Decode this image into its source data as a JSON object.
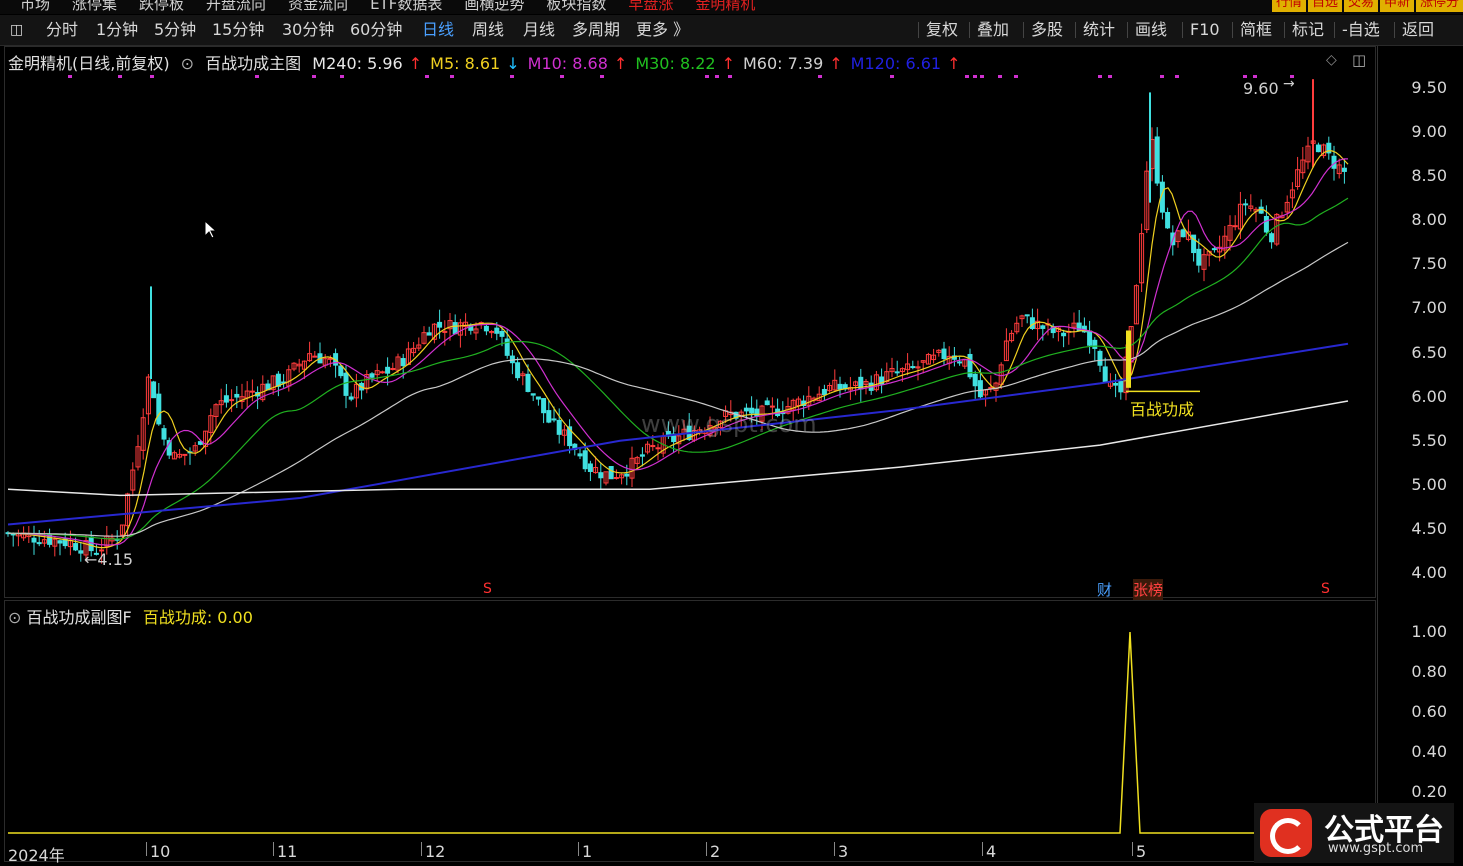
{
  "top_menu": {
    "items": [
      "市场",
      "涨停集",
      "跌停板",
      "开盘流向",
      "资金流向",
      "ETF数据表",
      "画横逆势",
      "板块指数",
      "早盘涨",
      "金明精机"
    ],
    "tabs": [
      "行情",
      "自选",
      "交易",
      "申新",
      "涨停分"
    ]
  },
  "toolbar": {
    "periods": [
      "分时",
      "1分钟",
      "5分钟",
      "15分钟",
      "30分钟",
      "60分钟",
      "日线",
      "周线",
      "月线",
      "多周期",
      "更多 》"
    ],
    "active_period": "日线",
    "actions": [
      "复权",
      "叠加",
      "多股",
      "统计",
      "画线",
      "F10",
      "简框",
      "标记",
      "-自选",
      "返回"
    ]
  },
  "main_legend": {
    "title": "金明精机(日线,前复权)",
    "indicator": "百战功成主图",
    "items": [
      {
        "label": "M240: 5.96",
        "arrow": "↑",
        "color": "#e8e8e8",
        "arrow_color": "#ff3030"
      },
      {
        "label": "M5: 8.61",
        "arrow": "↓",
        "color": "#f0d020",
        "arrow_color": "#20c0ff"
      },
      {
        "label": "M10: 8.68",
        "arrow": "↑",
        "color": "#d030d0",
        "arrow_color": "#ff3030"
      },
      {
        "label": "M30: 8.22",
        "arrow": "↑",
        "color": "#20c020",
        "arrow_color": "#ff3030"
      },
      {
        "label": "M60: 7.39",
        "arrow": "↑",
        "color": "#d0d0d0",
        "arrow_color": "#ff3030"
      },
      {
        "label": "M120: 6.61",
        "arrow": "↑",
        "color": "#2020e0",
        "arrow_color": "#ff3030"
      }
    ]
  },
  "sub_legend": {
    "indicator": "百战功成副图F",
    "value_label": "百战功成: 0.00"
  },
  "y_axis_main": [
    "9.50",
    "9.00",
    "8.50",
    "8.00",
    "7.50",
    "7.00",
    "6.50",
    "6.00",
    "5.50",
    "5.00",
    "4.50",
    "4.00"
  ],
  "y_axis_sub": [
    "1.00",
    "0.80",
    "0.60",
    "0.40",
    "0.20"
  ],
  "x_axis": [
    "2024年",
    "10",
    "11",
    "12",
    "1",
    "2",
    "3",
    "4",
    "5"
  ],
  "annotations": {
    "high": "9.60",
    "low": "←4.15",
    "signal": "百战功成",
    "badge_cai": "财",
    "badge_zhangbang": "张榜",
    "s_marker": "S"
  },
  "watermark": {
    "brand": "公式平台",
    "url": "www.gspt.com",
    "center_mark": "www.gspt.com"
  },
  "colors": {
    "up": "#ff3c3c",
    "down": "#40e0e0",
    "ma5": "#f0d020",
    "ma10": "#d030d0",
    "ma30": "#20b020",
    "ma60": "#c8c8c8",
    "ma120": "#2828d0",
    "ma240": "#e8e8e8",
    "signal": "#f0e020"
  }
}
